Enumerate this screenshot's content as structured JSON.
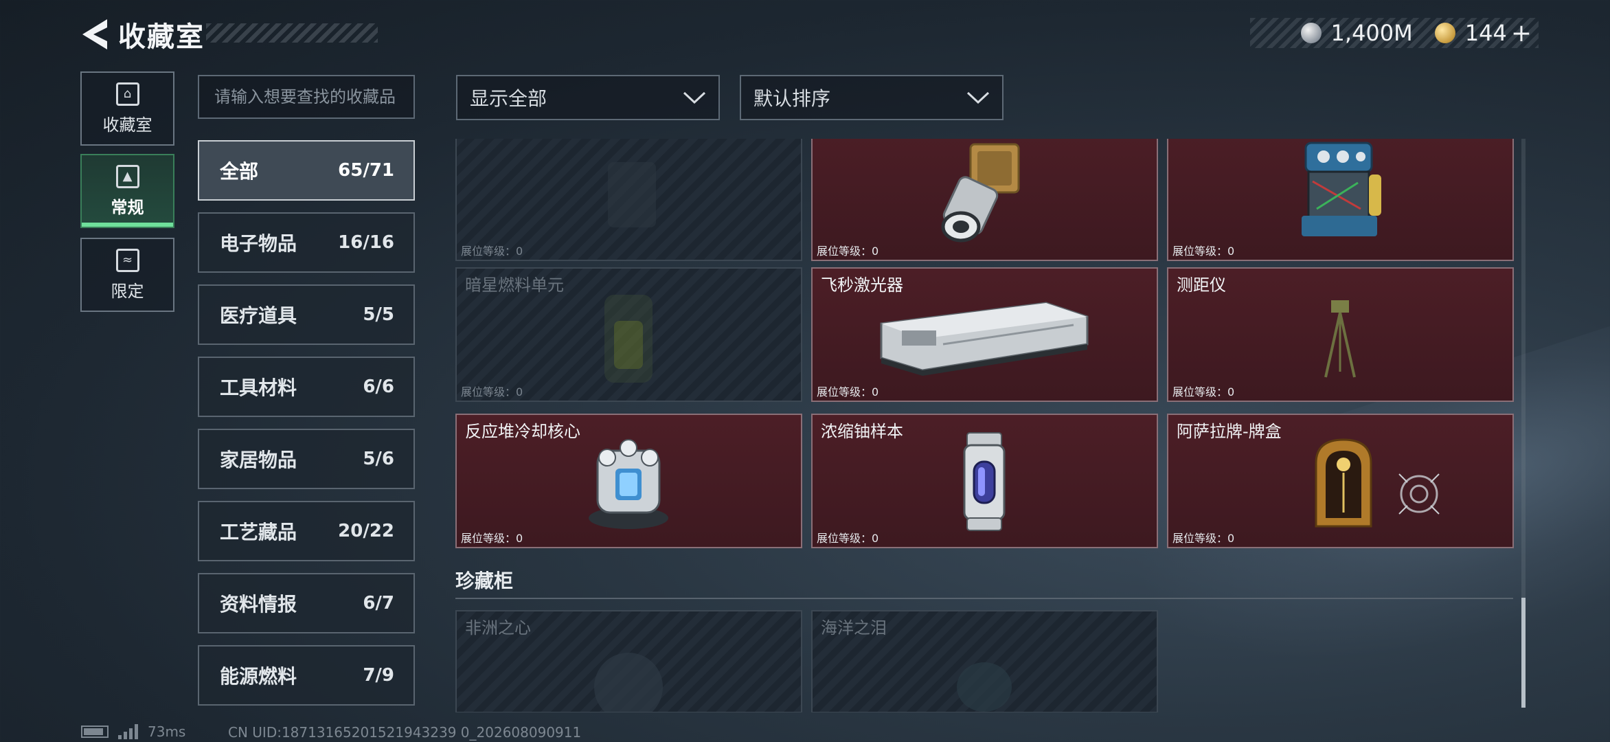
{
  "header": {
    "title": "收藏室"
  },
  "currency": {
    "silver": "1,400M",
    "gold": "144"
  },
  "nav": [
    {
      "label": "收藏室",
      "icon": "collection-room-icon"
    },
    {
      "label": "常规",
      "icon": "regular-icon",
      "active": true
    },
    {
      "label": "限定",
      "icon": "limited-icon"
    }
  ],
  "search": {
    "placeholder": "请输入想要查找的收藏品"
  },
  "filters": {
    "show": "显示全部",
    "sort": "默认排序"
  },
  "categories": [
    {
      "name": "全部",
      "count": "65/71",
      "active": true
    },
    {
      "name": "电子物品",
      "count": "16/16"
    },
    {
      "name": "医疗道具",
      "count": "5/5"
    },
    {
      "name": "工具材料",
      "count": "6/6"
    },
    {
      "name": "家居物品",
      "count": "5/6"
    },
    {
      "name": "工艺藏品",
      "count": "20/22"
    },
    {
      "name": "资料情报",
      "count": "6/7"
    },
    {
      "name": "能源燃料",
      "count": "7/9"
    }
  ],
  "level_label": "展位等级：0",
  "items": [
    {
      "name": "",
      "owned": false,
      "icon": "battery-icon"
    },
    {
      "name": "",
      "owned": true,
      "icon": "camera-lens-icon"
    },
    {
      "name": "",
      "owned": true,
      "icon": "machine-icon"
    },
    {
      "name": "暗星燃料单元",
      "owned": false,
      "icon": "fuel-cell-icon"
    },
    {
      "name": "飞秒激光器",
      "owned": true,
      "icon": "laser-device-icon"
    },
    {
      "name": "测距仪",
      "owned": true,
      "icon": "rangefinder-icon"
    },
    {
      "name": "反应堆冷却核心",
      "owned": true,
      "icon": "reactor-core-icon"
    },
    {
      "name": "浓缩铀样本",
      "owned": true,
      "icon": "uranium-canister-icon"
    },
    {
      "name": "阿萨拉牌-牌盒",
      "owned": true,
      "icon": "card-box-icon"
    }
  ],
  "cabinet": {
    "title": "珍藏柜",
    "items": [
      {
        "name": "非洲之心",
        "owned": false
      },
      {
        "name": "海洋之泪",
        "owned": false
      }
    ]
  },
  "footer": {
    "ping": "73ms",
    "uid": "CN UID:18713165201521943239 0_202608090911"
  },
  "colors": {
    "owned_card": "#4c1e26",
    "active_nav": "#6fe09b"
  }
}
